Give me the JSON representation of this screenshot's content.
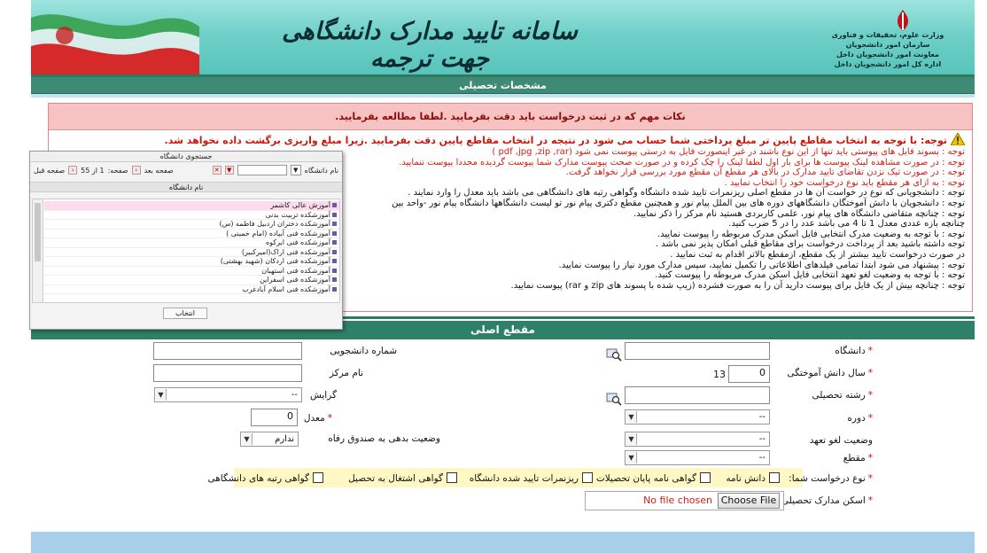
{
  "header": {
    "site_title": "سامانه تایید مدارک دانشگاهی جهت ترجمه",
    "ministry_lines": [
      "وزارت علوم، تحقیقات و فناوری",
      "سازمان امور دانشجویان",
      "معاونت امور دانشجویان داخل",
      "اداره کل امور دانشجویان داخل"
    ]
  },
  "section_title": "مشخصات تحصیلی",
  "notes": {
    "title": "نکات مهم که در ثبت درخواست باید دقت بفرمایید .لطفا مطالعه بفرمایید.",
    "warning": "توجه: با توجه به انتخاب مقاطع پایین تر مبلغ پرداختی شما حساب می شود در نتیجه در انتخاب مقاطع پایین دقت بفرمایید .زیرا مبلغ واریزی برگشت داده نخواهد شد.",
    "lines": [
      {
        "text": "توجه : پسوند فایل های پیوستی باید تنها از این نوع باشند در غیر اینصورت فایل به درستی پیوست نمی شود (pdf ,jpg ,zip ,rar )",
        "color": "red"
      },
      {
        "text": "توجه : در صورت مشاهده لینک پیوست ها برای بار اول لطفا لینک را چک کرده و در صورت صحت پیوست مدارک شما پیوست گردیده مجددا پیوست ننمایید.",
        "color": "red"
      },
      {
        "text": "توجه : در صورت تیک نزدن تقاضای تایید مدارک در بالای هر مقطع آن مقطع مورد بررسی قرار نخواهد گرفت.",
        "color": "red"
      },
      {
        "text": "توجه : به ازای هر مقطع باید نوع درخواست خود را انتخاب نمایید .",
        "color": "red"
      },
      {
        "text": "توجه : دانشجویانی که نوع در خواست آن ها در مقطع اصلی ریزنمرات تایید شده دانشگاه وگواهی رتبه های دانشگاهی می باشد باید معدل را وارد نمایند .",
        "color": "black"
      },
      {
        "text": "توجه : دانشجویان با دانش آموختگان دانشگاههای دوره های بین الملل پیام نور و همچنین مقطع دکتری پیام نور تو لیست دانشگاهها دانشگاه پیام نور -واحد بین",
        "color": "black"
      },
      {
        "text": "توجه : چنانچه متقاضی دانشگاه های پیام نور، علمی کاربردی هستید نام مرکز را ذکر نمایید.",
        "color": "black"
      },
      {
        "text": "چنانچه بازه عددی معدل 1 تا 4 می باشد عدد را در 5 ضرب کنید.",
        "color": "black"
      },
      {
        "text": "توجه : با توجه به وضعیت مدرک انتخابی فایل اسکن مدرک مربوطه را پیوست نمایید.",
        "color": "black"
      },
      {
        "text": "توجه داشته باشید بعد از پرداخت درخواست برای مقاطع قبلی امکان پذیر نمی باشد .",
        "color": "black"
      },
      {
        "text": "در صورت درخواست تایید بیشتر از یک مقطع، ازمقطع بالاتر اقدام به ثبت نمایید .",
        "color": "black"
      },
      {
        "text": "توجه : پیشنهاد می شود ابتدا تمامی فیلدهای اطلاعاتی را تکمیل نمایید، سپس مدارک مورد نیاز را پیوست نمایید.",
        "color": "black"
      },
      {
        "text": "توجه : با توجه به وضعیت لغو تعهد انتخابی فایل اسکن مدرک مربوطه را پیوست کنید.",
        "color": "black"
      },
      {
        "text": "توجه : چنانچه بیش از یک فایل برای پیوست دارید آن را به صورت فشرده (زیپ شده با پسوند های zip و rar) پیوست نمایید.",
        "color": "black"
      }
    ]
  },
  "popup": {
    "title": "جستجوی دانشگاه",
    "field_label": "نام دانشگاه",
    "page_label": "صفحه:",
    "page_value": "1 از 55",
    "next_label": "صفحه بعد",
    "prev_label": "صفحه قبل",
    "column_header": "نام دانشگاه",
    "items": [
      "آموزش عالی کاشمر",
      "آموزشکده تربیت بدنی",
      "آموزشکده دختران اردبیل فاطمه (س)",
      "آموزشکده فنی آبیاده (امام خمینی )",
      "آموزشکده فنی ابرکوه",
      "آموزشکده فنی اراک(امیرکبیر)",
      "آموزشکده فنی اردکان (شهید بهشتی)",
      "آموزشکده فنی استهبان",
      "آموزشکده فنی اسفراین",
      "آموزشکده فنی اسلام آبادغرب"
    ],
    "select_button": "انتخاب"
  },
  "form": {
    "title": "مقطع اصلی",
    "university_label": "دانشگاه",
    "student_number_label": "شماره دانشجویی",
    "grad_year_label": "سال دانش آموختگی",
    "grad_year_value": "0",
    "grad_year_prefix": "13",
    "center_name_label": "نام مرکز",
    "field_label": "رشته تحصیلی",
    "orientation_label": "گرایش",
    "orientation_value": "--",
    "course_label": "دوره",
    "course_value": "--",
    "gpa_label": "معدل",
    "gpa_value": "0",
    "commitment_label": "وضعیت لغو تعهد",
    "commitment_value": "--",
    "debt_label": "وضعیت بدهی به صندوق رفاه",
    "debt_value": "ندارم",
    "degree_label": "مقطع",
    "degree_value": "--",
    "request_type_label": "نوع درخواست شما:",
    "request_options": [
      "دانش نامه",
      "گواهی نامه پایان تحصیلات",
      "ریزنمرات تایید شده دانشگاه",
      "گواهی اشتغال به تحصیل",
      "گواهی رتبه های دانشگاهی"
    ],
    "scan_label": "اسکن مدارک تحصیلی و نامه های لغو تعهد",
    "file_button": "Choose File",
    "file_status": "No file chosen"
  },
  "colors": {
    "header_teal": "#6fd0c8",
    "bar_green": "#2f8069",
    "note_title_bg": "#f6c2c2",
    "warning_red": "#c4190f",
    "request_strip": "#fff8c4",
    "footer_blue": "#a7cfe9"
  }
}
